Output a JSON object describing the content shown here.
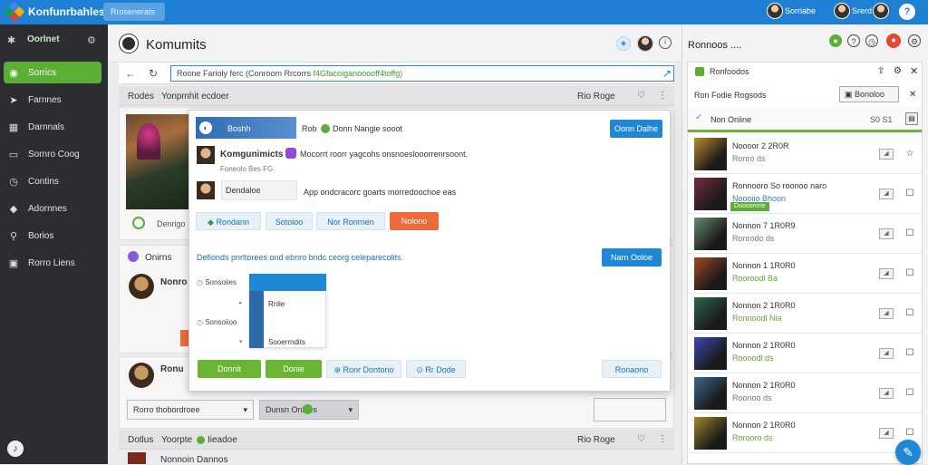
{
  "app": {
    "title": "Konfunrbahlest",
    "search_placeholder": "Rrosenerats"
  },
  "topbar": {
    "user1": "Sorriabe",
    "user2": "Srerd",
    "help": "?"
  },
  "sidebar": {
    "header": "Oorlnet",
    "items": [
      {
        "label": "Sorrics",
        "icon": "chat-icon"
      },
      {
        "label": "Farnnes",
        "icon": "tag-icon"
      },
      {
        "label": "Darnnals",
        "icon": "grid-icon"
      },
      {
        "label": "Sornro Coog",
        "icon": "window-icon"
      },
      {
        "label": "Contins",
        "icon": "clock-icon"
      },
      {
        "label": "Adornnes",
        "icon": "diamond-icon"
      },
      {
        "label": "Borios",
        "icon": "person-icon"
      },
      {
        "label": "Rorro Liens",
        "icon": "book-icon"
      }
    ]
  },
  "main": {
    "title": "Komumits",
    "url_prefix": "Roone Farioly ferc (Conroom Rrcorrs ",
    "url_highlight": "f4Gfacoiganooooff4toffg)",
    "row1_left": "Rodes",
    "row1_mid": "Yonpmhit ecdoer",
    "row1_right": "Rio Roge",
    "feed_label": "Denrigo",
    "feed2_label": "Onirns",
    "feed3_name": "Nonro",
    "feed4_name": "Ronu",
    "bottom_select": "Rorro thobordroee",
    "bottom_btn": "Dunsn Onloes",
    "row2_left": "Dotlus",
    "row2_mid": "Yoorpte",
    "row2_right": "Rio Roge",
    "row2_far": "Iieadoe",
    "last_row": "Nonnoin Dannos"
  },
  "dialog": {
    "banner": "Boshh",
    "tag_label": "Rob",
    "tag_text": "Donn Nangie sooot",
    "primary_btn": "Oonn Dalhe",
    "user_title": "Komgunimicts",
    "user_desc": "Mocorrt roorr yagcohs onsnoeslooorrenrsoont.",
    "user_sub": "Foneolo Bes FG",
    "field_label": "Dendaloe",
    "field_desc": "App ondcracorc goarts morredoochoe eas",
    "tab1": "Rondann",
    "tab2": "Sotoioo",
    "tab3": "Nor Ronrnen",
    "tab4": "Nolono",
    "link_text": "Defionds pnrltorees ond ebnro bndc ceorg celeparecolits.",
    "link_btn": "Narn Ooloe",
    "opt1": "Sonsoiies",
    "opt2": "Sonsoiioo",
    "dd_item1": "Rnlie",
    "dd_item2": "Sooerrndits",
    "footer_btn1": "Donnit",
    "footer_btn2": "Donie",
    "footer_btn3": "Ronr Dontono",
    "footer_btn4": "Rr Dode",
    "footer_btn5": "Ronaono"
  },
  "right_panel": {
    "title": "Ronnoos ....",
    "box_title": "Ronfoodos",
    "search_label": "Ron Fodie Rogsods",
    "search_btn": "Bonoloo",
    "online_label": "Non Online",
    "online_count": "S0 S1",
    "rows": [
      {
        "name": "Noooor 2 2R0R",
        "sub": "Ronro ds",
        "sub_color": "#777777",
        "thumb": "#c18a2e"
      },
      {
        "name": "Ronnooro So roonoo naro",
        "sub": "Noooiio Bhoon",
        "sub_color": "#2b7fc3",
        "thumb": "#7a2c3a",
        "badge": "Doooonrne"
      },
      {
        "name": "Nonnon 7 1R0R9",
        "sub": "Ronrodo ds",
        "sub_color": "#777777",
        "thumb": "#6b8a72"
      },
      {
        "name": "Nonnon 1 1R0R0",
        "sub": "Rooroodl Ba",
        "sub_color": "#6aa337",
        "thumb": "#a24b21"
      },
      {
        "name": "Nonnon 2 1R0R0",
        "sub": "Ronnoodl Nia",
        "sub_color": "#6aa337",
        "thumb": "#2a6a4a"
      },
      {
        "name": "Nonnon 2 1R0R0",
        "sub": "Roonodl ds",
        "sub_color": "#6aa337",
        "thumb": "#3a4ab2"
      },
      {
        "name": "Nonnon 2 1R0R0",
        "sub": "Roonoo ds",
        "sub_color": "#777777",
        "thumb": "#3a6a8a"
      },
      {
        "name": "Nonnon 2 1R0R0",
        "sub": "Rorooro ds",
        "sub_color": "#6aa337",
        "thumb": "#a28a2a"
      }
    ]
  }
}
